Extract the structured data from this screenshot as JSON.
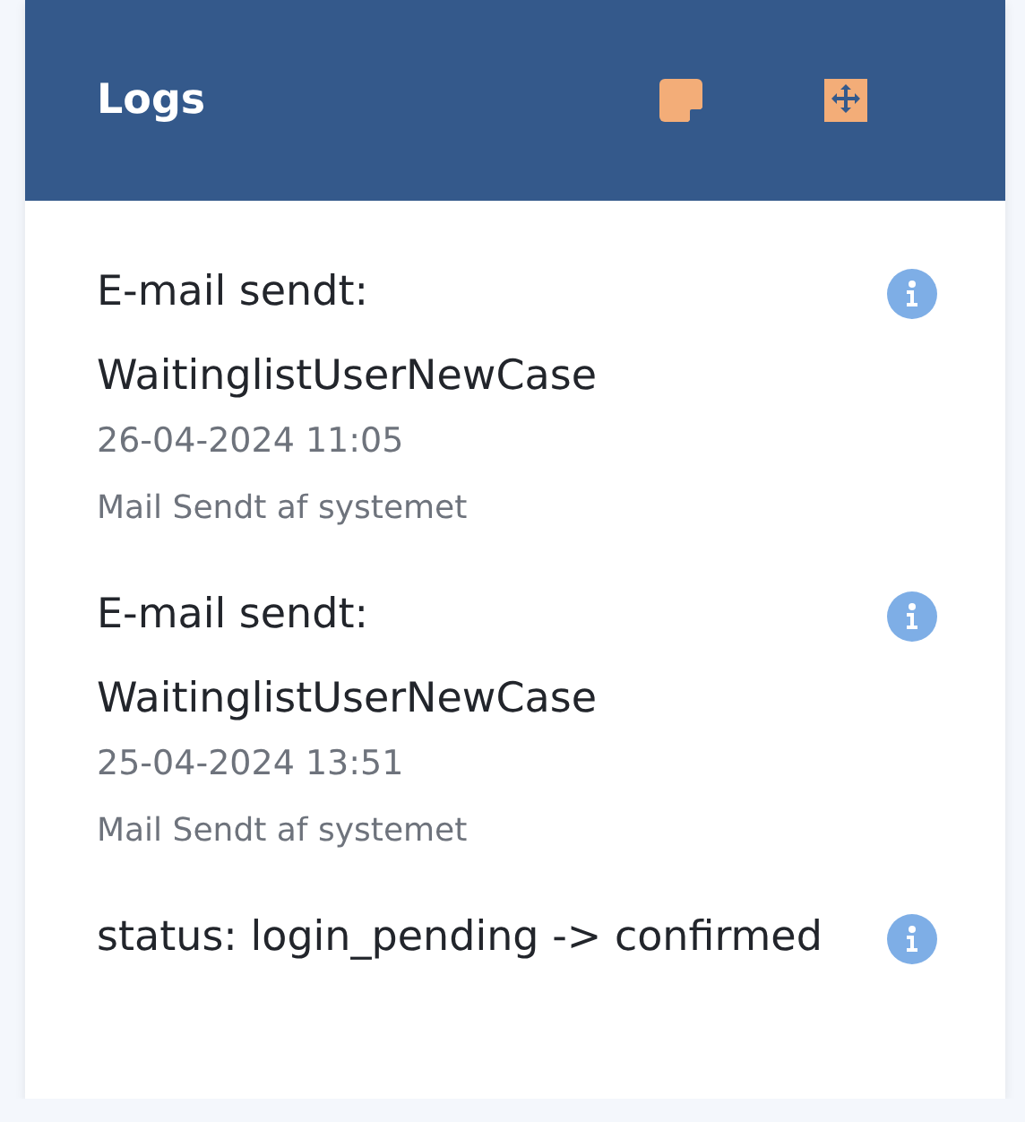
{
  "panel": {
    "title": "Logs"
  },
  "logs": [
    {
      "title": "E-mail sendt: WaitinglistUserNewCase",
      "date": "26-04-2024 11:05",
      "note": "Mail Sendt af systemet"
    },
    {
      "title": "E-mail sendt: WaitinglistUserNewCase",
      "date": "25-04-2024 13:51",
      "note": "Mail Sendt af systemet"
    },
    {
      "title": "status: login_pending -> confirmed"
    }
  ]
}
